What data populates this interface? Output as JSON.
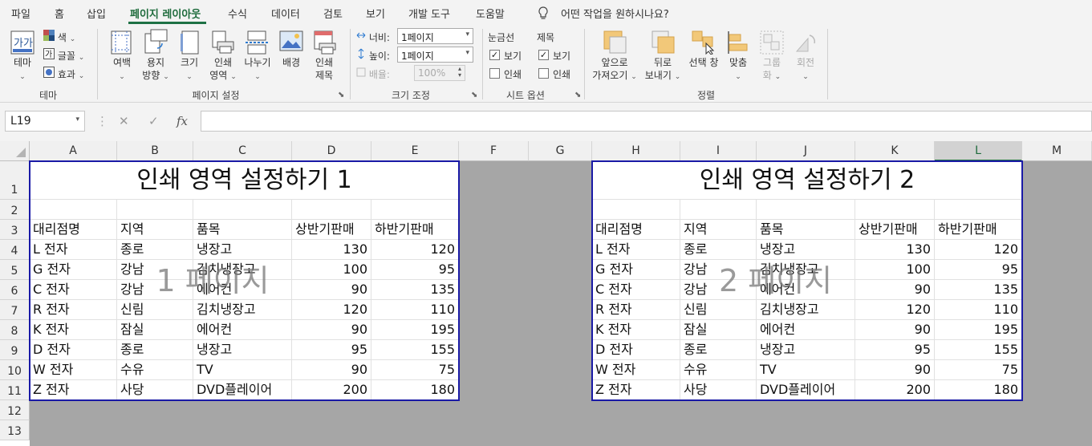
{
  "menu": {
    "tabs": [
      "파일",
      "홈",
      "삽입",
      "페이지 레이아웃",
      "수식",
      "데이터",
      "검토",
      "보기",
      "개발 도구",
      "도움말"
    ],
    "active_tab": "페이지 레이아웃",
    "tell_me": "어떤 작업을 원하시나요?"
  },
  "ribbon": {
    "theme": {
      "themes_label": "테마",
      "colors_label": "색",
      "fonts_label": "글꼴",
      "effects_label": "효과",
      "group_label": "테마"
    },
    "page_setup": {
      "margins": "여백",
      "orientation_1": "용지",
      "orientation_2": "방향",
      "size": "크기",
      "print_area_1": "인쇄",
      "print_area_2": "영역",
      "breaks": "나누기",
      "background": "배경",
      "print_titles_1": "인쇄",
      "print_titles_2": "제목",
      "group_label": "페이지 설정"
    },
    "scale": {
      "width_label": "너비:",
      "width_value": "1페이지",
      "height_label": "높이:",
      "height_value": "1페이지",
      "scale_label": "배율:",
      "scale_value": "100%",
      "group_label": "크기 조정"
    },
    "sheet_options": {
      "gridlines": "눈금선",
      "headings": "제목",
      "view": "보기",
      "print": "인쇄",
      "gridlines_view": true,
      "gridlines_print": false,
      "headings_view": true,
      "headings_print": false,
      "group_label": "시트 옵션"
    },
    "arrange": {
      "bring_forward_1": "앞으로",
      "bring_forward_2": "가져오기",
      "send_backward_1": "뒤로",
      "send_backward_2": "보내기",
      "selection_pane": "선택 창",
      "align": "맞춤",
      "group_1": "그룹",
      "group_2": "화",
      "rotate": "회전",
      "group_label": "정렬"
    }
  },
  "formula_bar": {
    "name_box": "L19",
    "cancel": "✕",
    "enter": "✓",
    "fx": "fx",
    "formula": ""
  },
  "columns": [
    "A",
    "B",
    "C",
    "D",
    "E",
    "F",
    "G",
    "H",
    "I",
    "J",
    "K",
    "L",
    "M"
  ],
  "selected_column": "L",
  "rows": [
    "1",
    "2",
    "3",
    "4",
    "5",
    "6",
    "7",
    "8",
    "9",
    "10",
    "11",
    "12",
    "13"
  ],
  "pages": [
    {
      "title": "인쇄 영역 설정하기 1",
      "watermark": "1 페이지",
      "headers": [
        "대리점명",
        "지역",
        "품목",
        "상반기판매",
        "하반기판매"
      ],
      "rows": [
        [
          "L 전자",
          "종로",
          "냉장고",
          "130",
          "120"
        ],
        [
          "G 전자",
          "강남",
          "김치냉장고",
          "100",
          "95"
        ],
        [
          "C 전자",
          "강남",
          "에어컨",
          "90",
          "135"
        ],
        [
          "R 전자",
          "신림",
          "김치냉장고",
          "120",
          "110"
        ],
        [
          "K 전자",
          "잠실",
          "에어컨",
          "90",
          "195"
        ],
        [
          "D 전자",
          "종로",
          "냉장고",
          "95",
          "155"
        ],
        [
          "W 전자",
          "수유",
          "TV",
          "90",
          "75"
        ],
        [
          "Z 전자",
          "사당",
          "DVD플레이어",
          "200",
          "180"
        ]
      ]
    },
    {
      "title": "인쇄 영역 설정하기 2",
      "watermark": "2 페이지",
      "headers": [
        "대리점명",
        "지역",
        "품목",
        "상반기판매",
        "하반기판매"
      ],
      "rows": [
        [
          "L 전자",
          "종로",
          "냉장고",
          "130",
          "120"
        ],
        [
          "G 전자",
          "강남",
          "김치냉장고",
          "100",
          "95"
        ],
        [
          "C 전자",
          "강남",
          "에어컨",
          "90",
          "135"
        ],
        [
          "R 전자",
          "신림",
          "김치냉장고",
          "120",
          "110"
        ],
        [
          "K 전자",
          "잠실",
          "에어컨",
          "90",
          "195"
        ],
        [
          "D 전자",
          "종로",
          "냉장고",
          "95",
          "155"
        ],
        [
          "W 전자",
          "수유",
          "TV",
          "90",
          "75"
        ],
        [
          "Z 전자",
          "사당",
          "DVD플레이어",
          "200",
          "180"
        ]
      ]
    }
  ],
  "colors": {
    "accent": "#217346",
    "page_border": "#1a1aa6",
    "outside_print_area": "#a6a6a6"
  }
}
